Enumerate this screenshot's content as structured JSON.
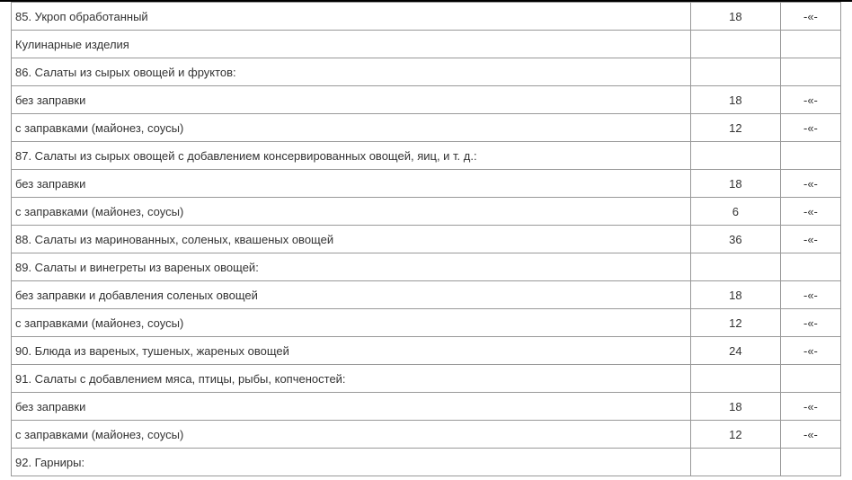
{
  "ditto": "-«-",
  "rows": [
    {
      "name": "85. Укроп обработанный",
      "value": "18",
      "mark": "-«-"
    },
    {
      "name": "Кулинарные изделия",
      "value": "",
      "mark": ""
    },
    {
      "name": "86. Салаты из сырых овощей и фруктов:",
      "value": "",
      "mark": ""
    },
    {
      "name": "без заправки",
      "value": "18",
      "mark": "-«-"
    },
    {
      "name": "с заправками (майонез, соусы)",
      "value": "12",
      "mark": "-«-"
    },
    {
      "name": "87. Салаты из сырых овощей с добавлением консервированных овощей, яиц, и т. д.:",
      "value": "",
      "mark": ""
    },
    {
      "name": "без заправки",
      "value": "18",
      "mark": "-«-"
    },
    {
      "name": "с заправками (майонез, соусы)",
      "value": "6",
      "mark": "-«-"
    },
    {
      "name": "88. Салаты из маринованных, соленых, квашеных овощей",
      "value": "36",
      "mark": "-«-"
    },
    {
      "name": "89. Салаты и винегреты из вареных овощей:",
      "value": "",
      "mark": ""
    },
    {
      "name": "без заправки и добавления соленых овощей",
      "value": "18",
      "mark": "-«-"
    },
    {
      "name": "с заправками (майонез, соусы)",
      "value": "12",
      "mark": "-«-"
    },
    {
      "name": "90. Блюда из вареных, тушеных, жареных овощей",
      "value": "24",
      "mark": "-«-"
    },
    {
      "name": "91. Салаты с добавлением мяса, птицы, рыбы, копченостей:",
      "value": "",
      "mark": ""
    },
    {
      "name": "без заправки",
      "value": "18",
      "mark": "-«-"
    },
    {
      "name": "с заправками (майонез, соусы)",
      "value": "12",
      "mark": "-«-"
    },
    {
      "name": "92. Гарниры:",
      "value": "",
      "mark": ""
    }
  ]
}
